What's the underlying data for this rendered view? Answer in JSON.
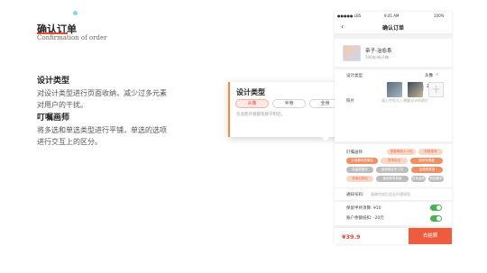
{
  "header": {
    "title": "确认订单",
    "subtitle": "Confirmation of order"
  },
  "sections": [
    {
      "title": "设计类型",
      "body": "对设计类型进行页面收纳，减少过多元素对用户的干扰。"
    },
    {
      "title": "叮嘱画师",
      "body": "将多选和单选类型进行平铺，单选的选项进行交互上的区分。"
    }
  ],
  "popup": {
    "title": "设计类型",
    "options": [
      "头像",
      "半身",
      "全身"
    ],
    "selected": "头像",
    "hint": "包含脸外貌部及脖子附近。"
  },
  "phone": {
    "status": {
      "carrier": "●●●●● LBS",
      "time": "9:41 AM",
      "battery": "100%"
    },
    "nav_title": "确认订单",
    "back_icon": "‹",
    "product": {
      "name": "亲子-治愈系",
      "sub": "500dpi电子稿"
    },
    "design_type": {
      "label": "设计类型",
      "value": "头像"
    },
    "quantity": {
      "minus": "-",
      "value": "2",
      "plus": "+"
    },
    "photo_hint": "请上传您与入想要设计的照片",
    "photo_label": "照片",
    "artist_label": "叮嘱画师",
    "tags": [
      {
        "text": "想要萌版人-4元",
        "style": "light"
      },
      {
        "text": "风格推荐",
        "style": "light"
      },
      {
        "text": "五观要有表情包",
        "style": "solid"
      },
      {
        "text": "表情突出",
        "style": "light"
      },
      {
        "text": "如何有角度",
        "style": "solid"
      },
      {
        "text": "保留原服饰",
        "style": "grey"
      },
      {
        "text": "画面简洁不-2元",
        "style": "grey"
      },
      {
        "text": "全角有笑容",
        "style": "solid"
      },
      {
        "text": "背景加颜色",
        "style": "light"
      },
      {
        "text": "使用原有背景",
        "style": "grey"
      },
      {
        "text": "日系画风",
        "style": "grey"
      },
      {
        "text": "其他要求",
        "style": "grey"
      }
    ],
    "notice_label": "通知号码:",
    "notice_hint": "画稿完成后会及时通知您",
    "insurance": {
      "label": "保留半终须算: ¥10",
      "on": true
    },
    "balance": {
      "label": "账户余额抵扣: -20元",
      "on": true
    },
    "price": "¥39.9",
    "pay_button": "去结算"
  }
}
